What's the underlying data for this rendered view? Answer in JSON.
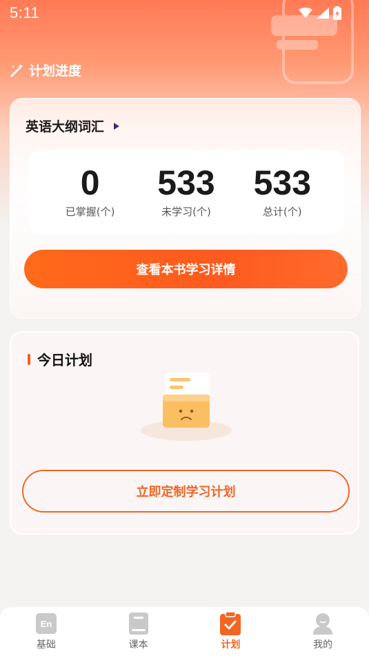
{
  "status": {
    "time": "5:11"
  },
  "header": {
    "title": "计划进度"
  },
  "progress": {
    "book_name": "英语大纲词汇",
    "stats": [
      {
        "value": "0",
        "label": "已掌握(个)"
      },
      {
        "value": "533",
        "label": "未学习(个)"
      },
      {
        "value": "533",
        "label": "总计(个)"
      }
    ],
    "detail_button": "查看本书学习详情"
  },
  "today_plan": {
    "title": "今日计划",
    "create_button": "立即定制学习计划"
  },
  "nav": {
    "items": [
      {
        "label": "基础",
        "icon": "en-icon"
      },
      {
        "label": "课本",
        "icon": "book-icon"
      },
      {
        "label": "计划",
        "icon": "plan-clipboard-icon"
      },
      {
        "label": "我的",
        "icon": "profile-icon"
      }
    ]
  },
  "colors": {
    "accent": "#f26522",
    "bg": "#f4f3f2"
  }
}
